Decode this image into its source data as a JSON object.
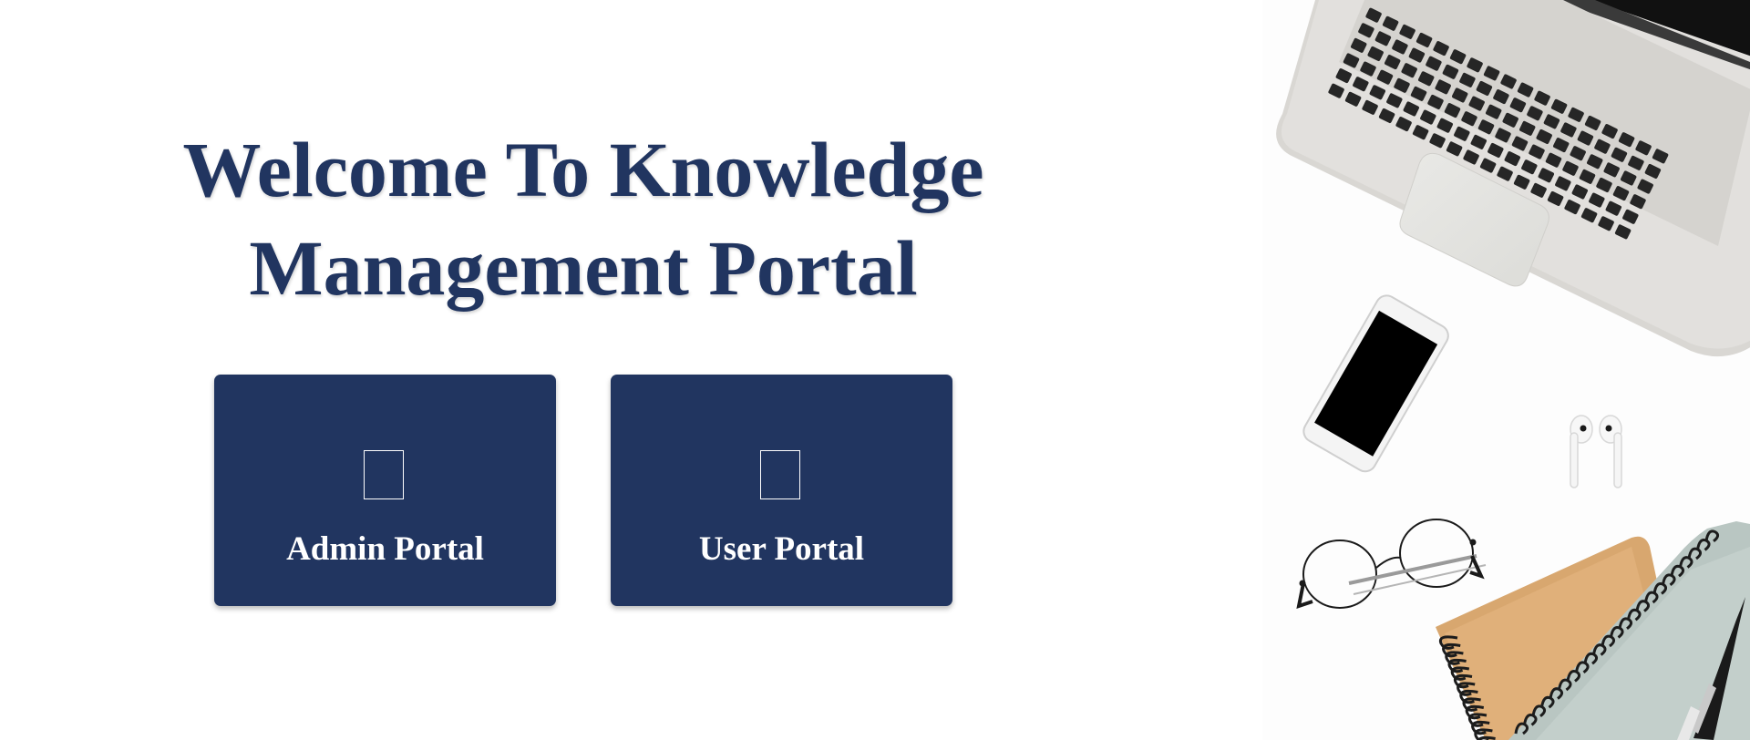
{
  "header": {
    "title_line1": "Welcome To Knowledge",
    "title_line2": "Management Portal"
  },
  "portals": [
    {
      "label": "Admin Portal",
      "icon": "admin-icon"
    },
    {
      "label": "User Portal",
      "icon": "user-icon"
    }
  ],
  "colors": {
    "brand": "#213560",
    "card_text": "#ffffff",
    "background": "#ffffff"
  },
  "decoration": {
    "items": [
      "laptop",
      "smartphone",
      "earbuds",
      "eyeglasses",
      "notebook",
      "pen"
    ]
  }
}
